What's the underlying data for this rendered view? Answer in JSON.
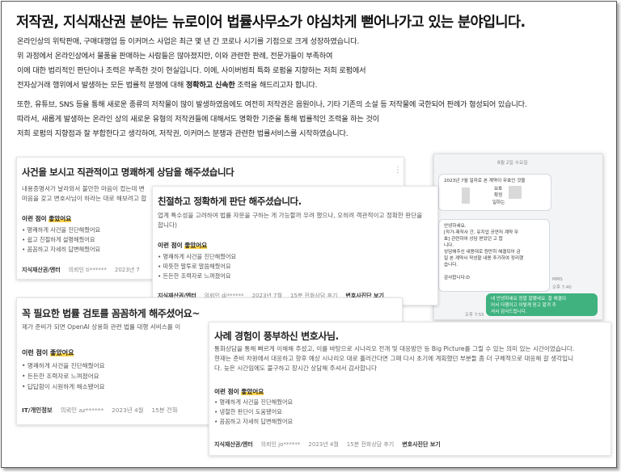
{
  "title": "저작권, 지식재산권 분야는 뉴로이어 법률사무소가 야심차게 뻗어나가고 있는 분야입니다.",
  "intro": {
    "line1": "온라인상의 위탁판매, 구매대행업 등 이커머스 사업은 최근 몇 년 간 코로나 시기를 기점으로 크게 성장하였습니다.",
    "line2": "위 과정에서 온라인상에서 물품을 판매하는 사람들은 많아졌지만, 이와 관련한 판례, 전문가들이 부족하여",
    "line3": "이에 대한 법리적인 판단이나 조력은 부족한 것이 현실입니다. 이에, 사이버범죄 특화 로펌을 지향하는 저희 로펌에서",
    "line4_a": "전자상거래 행위에서 발생하는 모든 법률적 분쟁에 대해 ",
    "line4_b": "정확하고 신속한",
    "line4_c": " 조력을 해드리고자 합니다."
  },
  "intro2": {
    "line1": "또한, 유튜브, SNS 등을 통해 새로운 종류의 저작물이 많이 발생하였음에도 여전히 저작권은 음원이나, 기타 기존의 소설 등 저작물에 국한되어 판례가 형성되어 있습니다.",
    "line2": "따라서, 새롭게 발생하는 온라인 상의 새로운 유형의 저작권들에 대해서도 명확한 기준을 통해 법률적인 조력을 하는 것이",
    "line3": "저희 로펌의 지향점과 잘 부합한다고 생각하여, 저작권, 이커머스 분쟁과 관련한 법률서비스를 시작하였습니다."
  },
  "reviews": {
    "r1": {
      "title": "사건을 보시고 직관적이고 명쾌하게 상담을 해주셨습니다",
      "text1": "내용증명서가 날라와서 불안한 마음이 컸는데 변",
      "text2": "마음을 갖고 변호사님이 하라는 대로 해보려고 합",
      "good_label": "이런 점이 좋았어요",
      "items": [
        "명쾌하게 사건을 진단해줬어요",
        "쉽고 친절하게 설명해줬어요",
        "꼼꼼하고 자세히 답변해줬어요"
      ],
      "cat": "지식재산권/엔터",
      "user": "의뢰인 ti******",
      "date": "2023년 7"
    },
    "r2": {
      "title": "친절하고 정확하게 판단 해주셨습니다.",
      "text1": "업계 특수성을 고려하여 법률 자문을 구하는 게 가능할까 우려 했으나, 오히려 객관적이고 정확한 판단을",
      "text2": "합니다)",
      "good_label": "이런 점이 좋았어요",
      "items": [
        "명쾌하게 사건을 진단해줬어요",
        "따뜻한 말투로 말씀해줬어요",
        "든든한 조력자로 느껴졌어요"
      ],
      "cat": "지식재산권/엔터",
      "user": "의뢰인 di******",
      "date": "2023년 7월",
      "type": "15분 전화상담 후기",
      "link": "변호사진단 보기"
    },
    "r3": {
      "title": "꼭 필요한 법률 검토를 꼼꼼하게 해주셨어요~",
      "text1": "제가 준비가 되면 OpenAI 상용화 관련 법률 대행 서비스를 이",
      "good_label": "이런 점이 좋았어요",
      "items": [
        "명쾌하게 사건을 진단해줬어요",
        "든든한 조력자로 느껴졌어요",
        "답답함이 시원하게 해소됐어요"
      ],
      "cat": "IT/개인정보",
      "user": "의뢰인 az******",
      "date": "2023년 4월",
      "type": "15분 전화"
    },
    "r4": {
      "title": "사례 경험이 풍부하신 변호사님.",
      "text1": "통화상담을 통해 빠르게 이해해 주셨고, 이를 바탕으로 시나리오 전개 및 대응방안 등 Big Picture를 그릴 수 있는 의미 있는 시간이었습니다.",
      "text2": "현재는 준비 차원에서 대응하고 향후 예상 시나리오 대로 흘러간다면 그때 다시 초기에 계획했던 부분들 좀 더 구체적으로 대응해 갈 생각입니",
      "text3": "다. 늦은 시간임에도 불구하고 장시간 상담해 주셔서 감사합니다",
      "good_label": "이런 점이 좋았어요",
      "items": [
        "명쾌하게 사건을 진단해줬어요",
        "냉철한 판단이 도움됐어요",
        "꼼꼼하고 자세히 답변해줬어요"
      ],
      "cat": "지식재산권/엔터",
      "user": "의뢰인 jo******",
      "date": "2023년 4월",
      "type": "15분 전화상담 후기",
      "link": "변호사진단 보기"
    }
  },
  "good_prefix": "이런 점이 ",
  "good_hl": "좋았어요",
  "chat": {
    "date": "8월 2일 수요일",
    "b1_line1": "2023년 7월      일자로 본 계약이 무효인 것을",
    "b1_line2": "보호",
    "b1_line3": "확정",
    "b1_line4": "일하는",
    "b2_lines": [
      "안녕하세요.",
      "[작가-제작사 간, 유지업 공연저 계약 무",
      "효] 관련하여 상담 받았던           고 합",
      "니다.",
      "상담해주신 내용대로 원만히 해결되어 금",
      "일 본 계약서 작성할 내용 추가하여 정리했",
      "습니다.",
      "",
      "감사합니다:D"
    ],
    "b2_mms": "MMS",
    "b2_time": "오후 7:40",
    "green_lines": [
      "네  안녕하세요 정말 잘됐네요. 잘 해결되",
      "어서 다행이고 이렇게 믿고 맡겨 주",
      "셔서 감사드립니다."
    ],
    "green_time": "오후 7:55"
  }
}
